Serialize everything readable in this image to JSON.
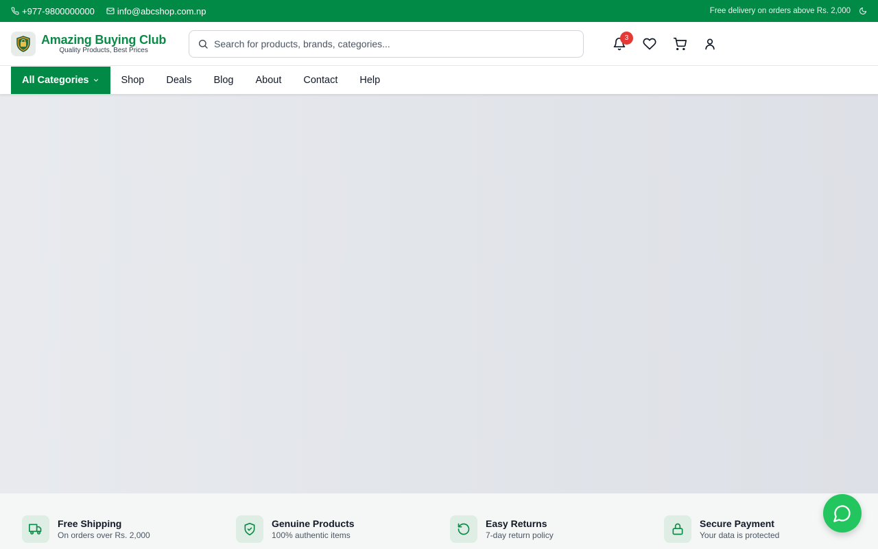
{
  "topbar": {
    "phone": "+977-9800000000",
    "email": "info@abcshop.com.np",
    "promo": "Free delivery on orders above Rs. 2,000"
  },
  "brand": {
    "name": "Amazing Buying Club",
    "tagline": "Quality Products, Best Prices"
  },
  "search": {
    "placeholder": "Search for products, brands, categories..."
  },
  "header_actions": {
    "notification_count": "3"
  },
  "nav": {
    "all_categories": "All Categories",
    "links": [
      "Shop",
      "Deals",
      "Blog",
      "About",
      "Contact",
      "Help"
    ]
  },
  "features": [
    {
      "title": "Free Shipping",
      "subtitle": "On orders over Rs. 2,000",
      "icon": "truck-icon"
    },
    {
      "title": "Genuine Products",
      "subtitle": "100% authentic items",
      "icon": "shield-check-icon"
    },
    {
      "title": "Easy Returns",
      "subtitle": "7-day return policy",
      "icon": "rotate-ccw-icon"
    },
    {
      "title": "Secure Payment",
      "subtitle": "Your data is protected",
      "icon": "lock-icon"
    }
  ],
  "colors": {
    "brand_green": "#008a45",
    "badge_red": "#e53935",
    "chat_green": "#22c55e"
  }
}
